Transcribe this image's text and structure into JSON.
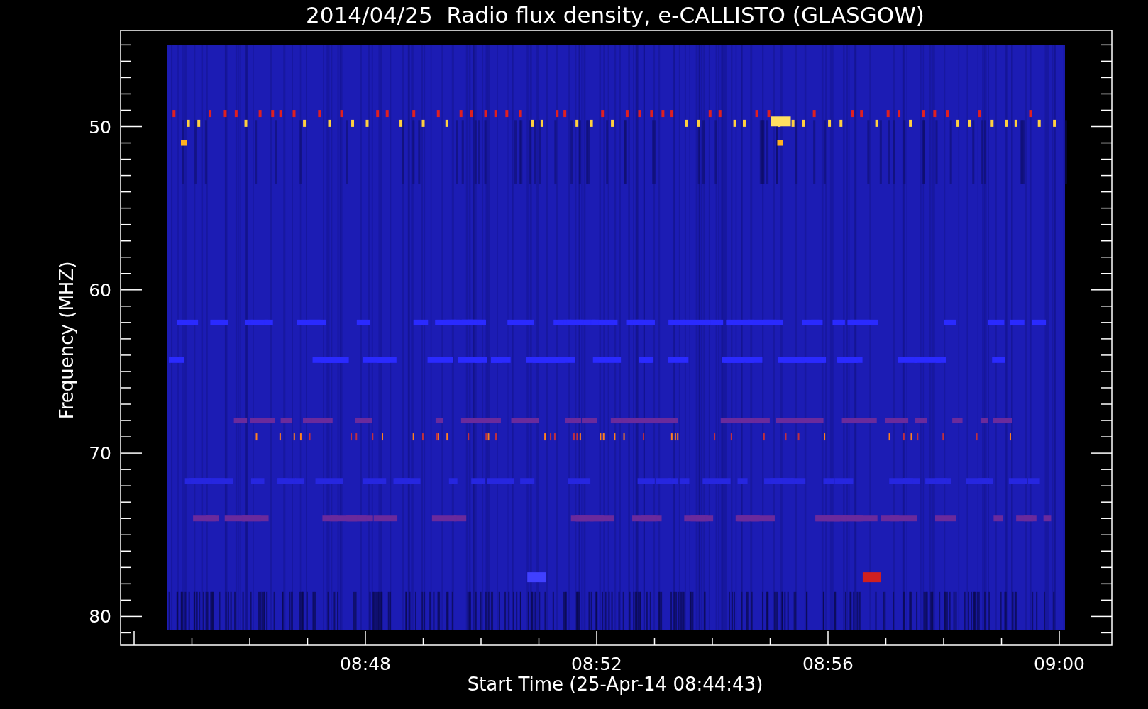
{
  "plot": {
    "title": "2014/04/25  Radio flux density, e-CALLISTO (GLASGOW)",
    "ylabel": "Frequency (MHZ)",
    "xlabel": "Start Time (25-Apr-14 08:44:43)",
    "yticks": [
      "50",
      "60",
      "70",
      "80"
    ],
    "xticks": [
      "08:48",
      "08:52",
      "08:56",
      "09:00"
    ]
  }
}
